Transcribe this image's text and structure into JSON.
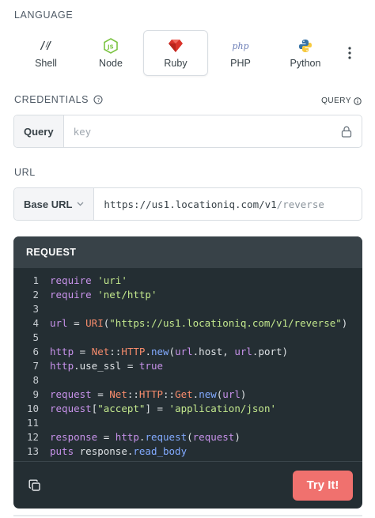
{
  "language": {
    "title": "LANGUAGE",
    "items": [
      {
        "label": "Shell",
        "icon": "shell-icon"
      },
      {
        "label": "Node",
        "icon": "node-icon"
      },
      {
        "label": "Ruby",
        "icon": "ruby-icon",
        "active": true
      },
      {
        "label": "PHP",
        "icon": "php-icon"
      },
      {
        "label": "Python",
        "icon": "python-icon"
      }
    ],
    "php_glyph": "php"
  },
  "credentials": {
    "title": "CREDENTIALS",
    "query_label": "QUERY",
    "field_label": "Query",
    "placeholder": "key"
  },
  "url": {
    "title": "URL",
    "base_label": "Base URL",
    "base": "https://us1.locationiq.com/v1",
    "path": "/reverse"
  },
  "request": {
    "title": "REQUEST",
    "line_numbers": [
      "1",
      "2",
      "3",
      "4",
      "5",
      "6",
      "7",
      "8",
      "9",
      "10",
      "11",
      "12",
      "13"
    ],
    "try_label": "Try It!"
  },
  "colors": {
    "accent": "#f0716e",
    "code_bg": "#242e33",
    "code_header": "#384248"
  }
}
